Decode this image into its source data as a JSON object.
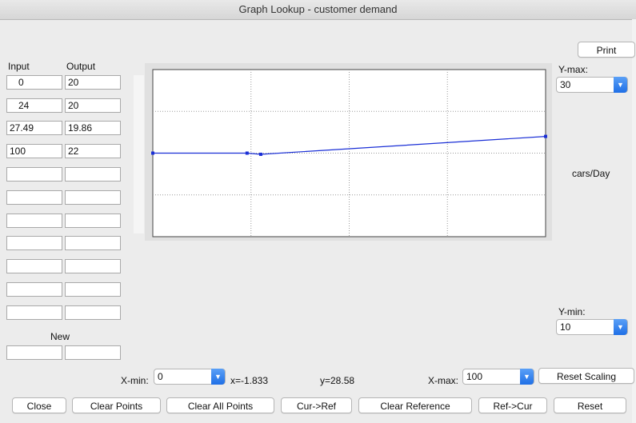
{
  "window": {
    "title": "Graph Lookup - customer demand"
  },
  "table": {
    "input_header": "Input",
    "output_header": "Output",
    "rows": [
      {
        "input": "0",
        "output": "20"
      },
      {
        "input": "24",
        "output": "20"
      },
      {
        "input": "27.49",
        "output": "19.86"
      },
      {
        "input": "100",
        "output": "22"
      },
      {
        "input": "",
        "output": ""
      },
      {
        "input": "",
        "output": ""
      },
      {
        "input": "",
        "output": ""
      },
      {
        "input": "",
        "output": ""
      },
      {
        "input": "",
        "output": ""
      },
      {
        "input": "",
        "output": ""
      },
      {
        "input": "",
        "output": ""
      }
    ],
    "new_label": "New",
    "new_input": "",
    "new_output": ""
  },
  "controls": {
    "print_label": "Print",
    "ymax_label": "Y-max:",
    "ymax_value": "30",
    "ymin_label": "Y-min:",
    "ymin_value": "10",
    "units": "cars/Day",
    "xmin_label": "X-min:",
    "xmin_value": "0",
    "xmax_label": "X-max:",
    "xmax_value": "100",
    "x_readout": "x=-1.833",
    "y_readout": "y=28.58",
    "reset_scaling_label": "Reset Scaling"
  },
  "buttons": {
    "close": "Close",
    "clear_points": "Clear Points",
    "clear_all_points": "Clear All Points",
    "cur_ref": "Cur->Ref",
    "clear_reference": "Clear Reference",
    "ref_cur": "Ref->Cur",
    "reset": "Reset"
  },
  "colors": {
    "curve": "#1a2fd6",
    "grid": "#9a9a9a",
    "accent": "#1f6fe6"
  },
  "chart_data": {
    "type": "line",
    "xlim": [
      0,
      100
    ],
    "ylim": [
      10,
      30
    ],
    "grid": true,
    "series": [
      {
        "x": [
          0,
          24,
          27.49,
          100
        ],
        "y": [
          20,
          20,
          19.86,
          22
        ]
      }
    ]
  }
}
